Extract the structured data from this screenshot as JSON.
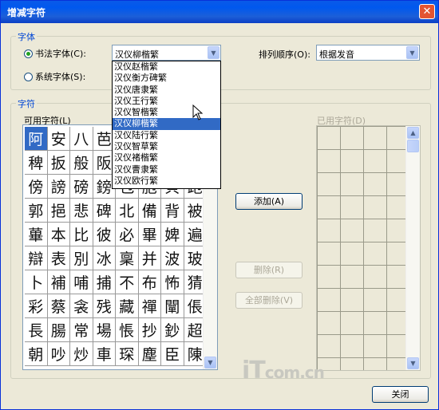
{
  "window": {
    "title": "增减字符",
    "close": "✕"
  },
  "font_group": {
    "label": "字体",
    "calligraphy_radio": "书法字体(C):",
    "system_radio": "系统字体(S):",
    "selected_font": "汉仪柳楷繁",
    "font_options": [
      "汉仪赵楷繁",
      "汉仪衡方碑繁",
      "汉仪唐隶繁",
      "汉仪王行繁",
      "汉仪智楷繁",
      "汉仪柳楷繁",
      "汉仪陆行繁",
      "汉仪智草繁",
      "汉仪褚楷繁",
      "汉仪曹隶繁",
      "汉仪欧行繁"
    ],
    "sort_label": "排列顺序(O):",
    "sort_value": "根据发音"
  },
  "chars_group": {
    "label": "字符",
    "available_label": "可用字符(L)",
    "used_label": "已用字符(D)",
    "chars": [
      "阿",
      "安",
      "八",
      "芭",
      "",
      "",
      "",
      "",
      "稗",
      "扳",
      "般",
      "阪",
      "",
      "",
      "",
      "",
      "傍",
      "謗",
      "磅",
      "鎊",
      "包",
      "胞",
      "貝",
      "跑",
      "郭",
      "挹",
      "悲",
      "碑",
      "北",
      "備",
      "背",
      "被",
      "蓽",
      "本",
      "比",
      "彼",
      "必",
      "畢",
      "婢",
      "遍",
      "辯",
      "表",
      "別",
      "冰",
      "稟",
      "并",
      "波",
      "玻",
      "卜",
      "補",
      "哺",
      "捕",
      "不",
      "布",
      "怖",
      "猜",
      "彩",
      "蔡",
      "衾",
      "残",
      "藏",
      "禪",
      "闡",
      "倀",
      "長",
      "腸",
      "常",
      "場",
      "悵",
      "抄",
      "鈔",
      "超",
      "朝",
      "吵",
      "炒",
      "車",
      "琛",
      "塵",
      "臣",
      "陳"
    ]
  },
  "buttons": {
    "add": "添加(A)",
    "delete": "删除(R)",
    "delete_all": "全部删除(V)",
    "close": "关闭"
  },
  "watermark": {
    "main": "iT",
    "mid": "com",
    "tail": ".cn"
  }
}
